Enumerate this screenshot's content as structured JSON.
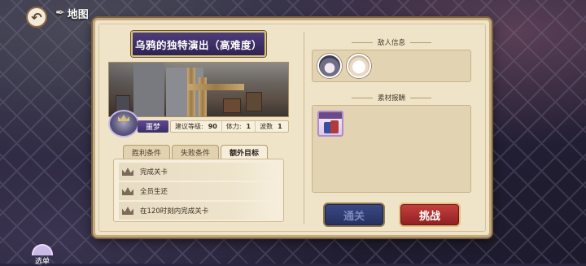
{
  "top_bar": {
    "back_icon": "undo-arrow-icon",
    "map_icon": "feather-icon",
    "map_label": "地图"
  },
  "stage": {
    "title": "乌鸦的独特演出（高难度）",
    "difficulty": "噩梦",
    "stats": [
      {
        "label": "建议等级:",
        "value": "90"
      },
      {
        "label": "体力:",
        "value": "1"
      },
      {
        "label": "波数",
        "value": "1"
      }
    ]
  },
  "tabs": [
    {
      "label": "胜利条件",
      "active": false
    },
    {
      "label": "失败条件",
      "active": false
    },
    {
      "label": "额外目标",
      "active": true
    }
  ],
  "objectives": [
    {
      "icon": "crown-icon",
      "text": "完成关卡"
    },
    {
      "icon": "crown-icon",
      "text": "全员生还"
    },
    {
      "icon": "crown-icon",
      "text": "在120时刻内完成关卡"
    }
  ],
  "enemy_section": {
    "title": "敌人信息"
  },
  "reward_section": {
    "title": "素材报酬"
  },
  "buttons": {
    "clear_label": "通关",
    "fight_label": "挑战"
  },
  "menu": {
    "label": "选单"
  },
  "colors": {
    "title_plate": "#3f2f6a",
    "fight_button": "#b0302f",
    "clear_button": "#313d74",
    "parchment": "#efe4c8"
  }
}
